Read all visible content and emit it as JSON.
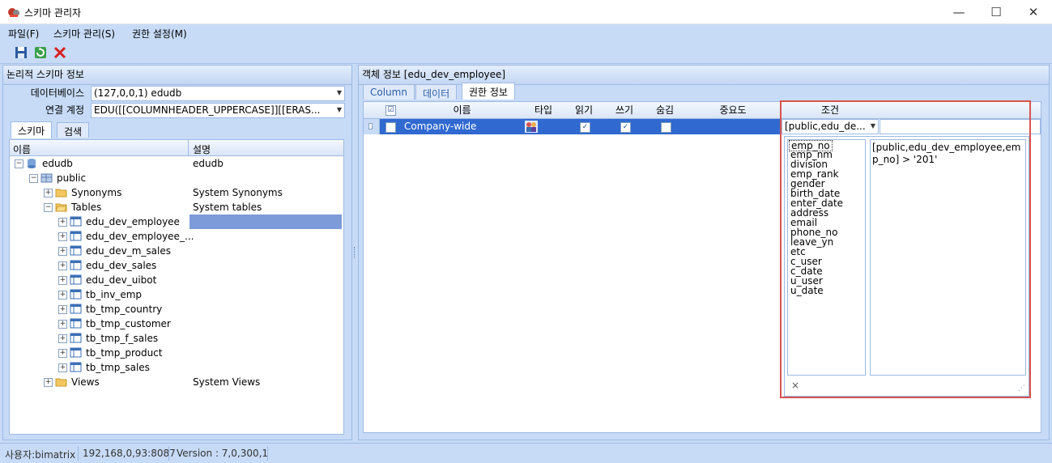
{
  "window": {
    "title": "스키마 관리자",
    "controls": [
      "—",
      "☐",
      "✕"
    ]
  },
  "menu": [
    "파일(F)",
    "스키마 관리(S)",
    "권한 설정(M)"
  ],
  "toolbar": {
    "icons": [
      "save-icon",
      "refresh-icon",
      "delete-icon"
    ]
  },
  "left_panel": {
    "title": "논리적 스키마 정보",
    "db_label": "데이터베이스",
    "db_value": "(127,0,0,1) edudb",
    "account_label": "연결 계정",
    "account_value": "EDU([[COLUMNHEADER_UPPERCASE]][[ERAS...",
    "tabs": [
      "스키마",
      "검색"
    ],
    "columns": [
      "이름",
      "설명"
    ],
    "tree": [
      {
        "label": "edudb",
        "desc": "edudb"
      },
      {
        "label": "public",
        "desc": ""
      },
      {
        "label": "Synonyms",
        "desc": "System Synonyms"
      },
      {
        "label": "Tables",
        "desc": "System tables"
      },
      {
        "label": "edu_dev_employee",
        "desc": ""
      },
      {
        "label": "edu_dev_employee_...",
        "desc": ""
      },
      {
        "label": "edu_dev_m_sales",
        "desc": ""
      },
      {
        "label": "edu_dev_sales",
        "desc": ""
      },
      {
        "label": "edu_dev_uibot",
        "desc": ""
      },
      {
        "label": "tb_inv_emp",
        "desc": ""
      },
      {
        "label": "tb_tmp_country",
        "desc": ""
      },
      {
        "label": "tb_tmp_customer",
        "desc": ""
      },
      {
        "label": "tb_tmp_f_sales",
        "desc": ""
      },
      {
        "label": "tb_tmp_product",
        "desc": ""
      },
      {
        "label": "tb_tmp_sales",
        "desc": ""
      },
      {
        "label": "Views",
        "desc": "System Views"
      }
    ]
  },
  "right_panel": {
    "title": "객체 정보  [edu_dev_employee]",
    "tabs": [
      "Column",
      "데이터",
      "권한 정보"
    ],
    "columns": [
      "☑",
      "이름",
      "타입",
      "읽기",
      "쓰기",
      "숨김",
      "중요도",
      "조건"
    ],
    "row": {
      "name": "Company-wide",
      "read": "✓",
      "write": "✓",
      "hidden": "",
      "condition": "[public,edu_de..."
    },
    "fields": [
      "emp_no",
      "emp_nm",
      "division",
      "emp_rank",
      "gender",
      "birth_date",
      "enter_date",
      "address",
      "email",
      "phone_no",
      "leave_yn",
      "etc",
      "c_user",
      "c_date",
      "u_user",
      "u_date"
    ],
    "condition_text": "[public,edu_dev_employee,emp_no] > '201'",
    "popup_close": "×"
  },
  "status": {
    "user": "사용자:bimatrix",
    "address": "192,168,0,93:8087",
    "version": "Version : 7,0,300,1"
  }
}
